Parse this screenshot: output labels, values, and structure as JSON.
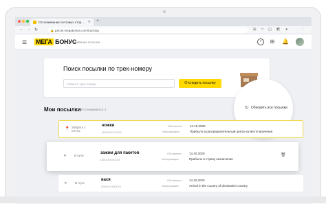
{
  "browser": {
    "tab_title": "Отслеживание почтовых отпр...",
    "url": "parcel.megabonus.com/tracking",
    "traffic_colors": [
      "#ff5f57",
      "#febc2e",
      "#28c840"
    ]
  },
  "header": {
    "logo_part1": "МЕГА",
    "logo_part2": "БОНУС",
    "subtitle": "Отслеживание посылок",
    "brand_color": "#ffd900"
  },
  "search": {
    "title": "Поиск посылки по трек-номеру",
    "placeholder": "Укажите трек-номер",
    "button": "Отследить посылку"
  },
  "parcels": {
    "title": "Мои посылки",
    "count": "Отслеживается 4",
    "refresh": "Обновить все посылки",
    "items": [
      {
        "status": "Забрать с почты",
        "name": "ножки",
        "code": "LBХXXXXXXXX",
        "label_date": "Обновлено",
        "date": "14.10.2020",
        "label_info": "Информация",
        "info": "Прибыло в распределительный центр на месте вручения"
      },
      {
        "status": "В пути",
        "name": "зажим для пакетов",
        "code": "LBХXXXXXXXX",
        "label_date": "Обновлено",
        "date": "14.10.2020",
        "label_info": "Информация",
        "info": "Прибыло в страну назначения"
      },
      {
        "status": "В пути",
        "name": "вася",
        "code": "LBХXXXXXXXX",
        "label_date": "Обновлено",
        "date": "14.10.2020",
        "label_info": "Информация",
        "info": "Arrival in the country of destination country"
      }
    ]
  }
}
